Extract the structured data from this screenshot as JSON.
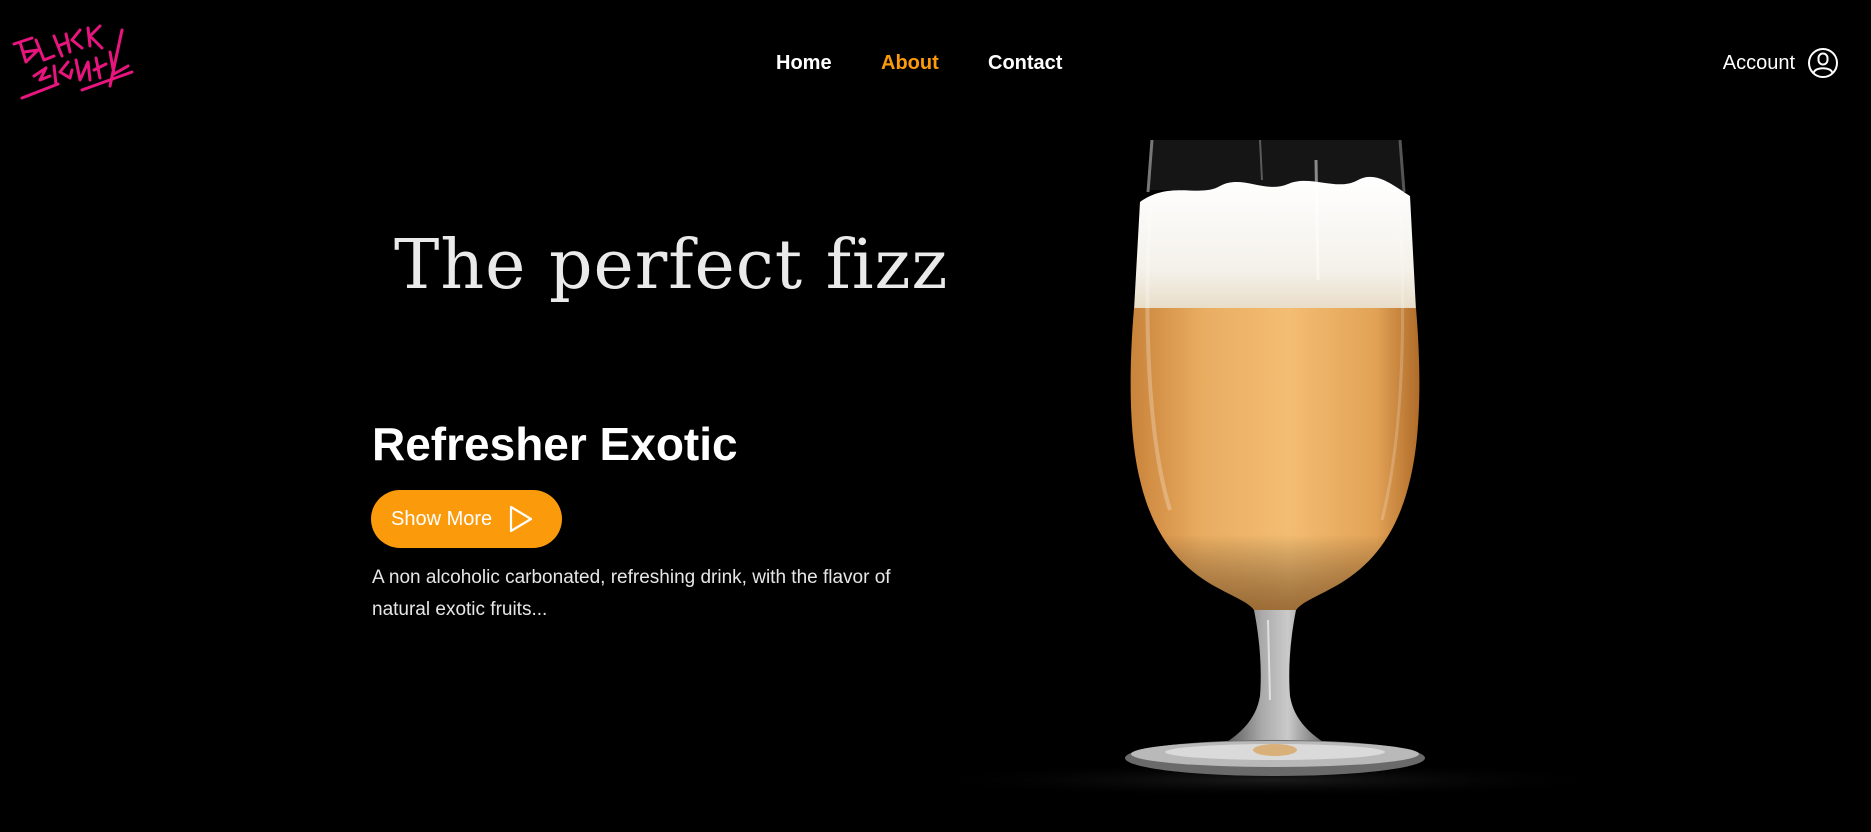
{
  "brand": {
    "logo_text": "BLACK SIGNAL",
    "logo_color": "#e8157f"
  },
  "nav": {
    "items": [
      {
        "label": "Home",
        "active": false
      },
      {
        "label": "About",
        "active": true
      },
      {
        "label": "Contact",
        "active": false
      }
    ],
    "active_color": "#fb9a0b"
  },
  "account": {
    "label": "Account",
    "icon": "user-circle-icon"
  },
  "hero": {
    "tagline": "The perfect fizz",
    "product_title": "Refresher Exotic",
    "cta_label": "Show More",
    "cta_icon": "play-outline-icon",
    "cta_color": "#fb9a0b",
    "description": "A non alcoholic carbonated, refreshing drink, with the flavor of natural exotic fruits..."
  },
  "image": {
    "subject": "glass-of-drink"
  }
}
